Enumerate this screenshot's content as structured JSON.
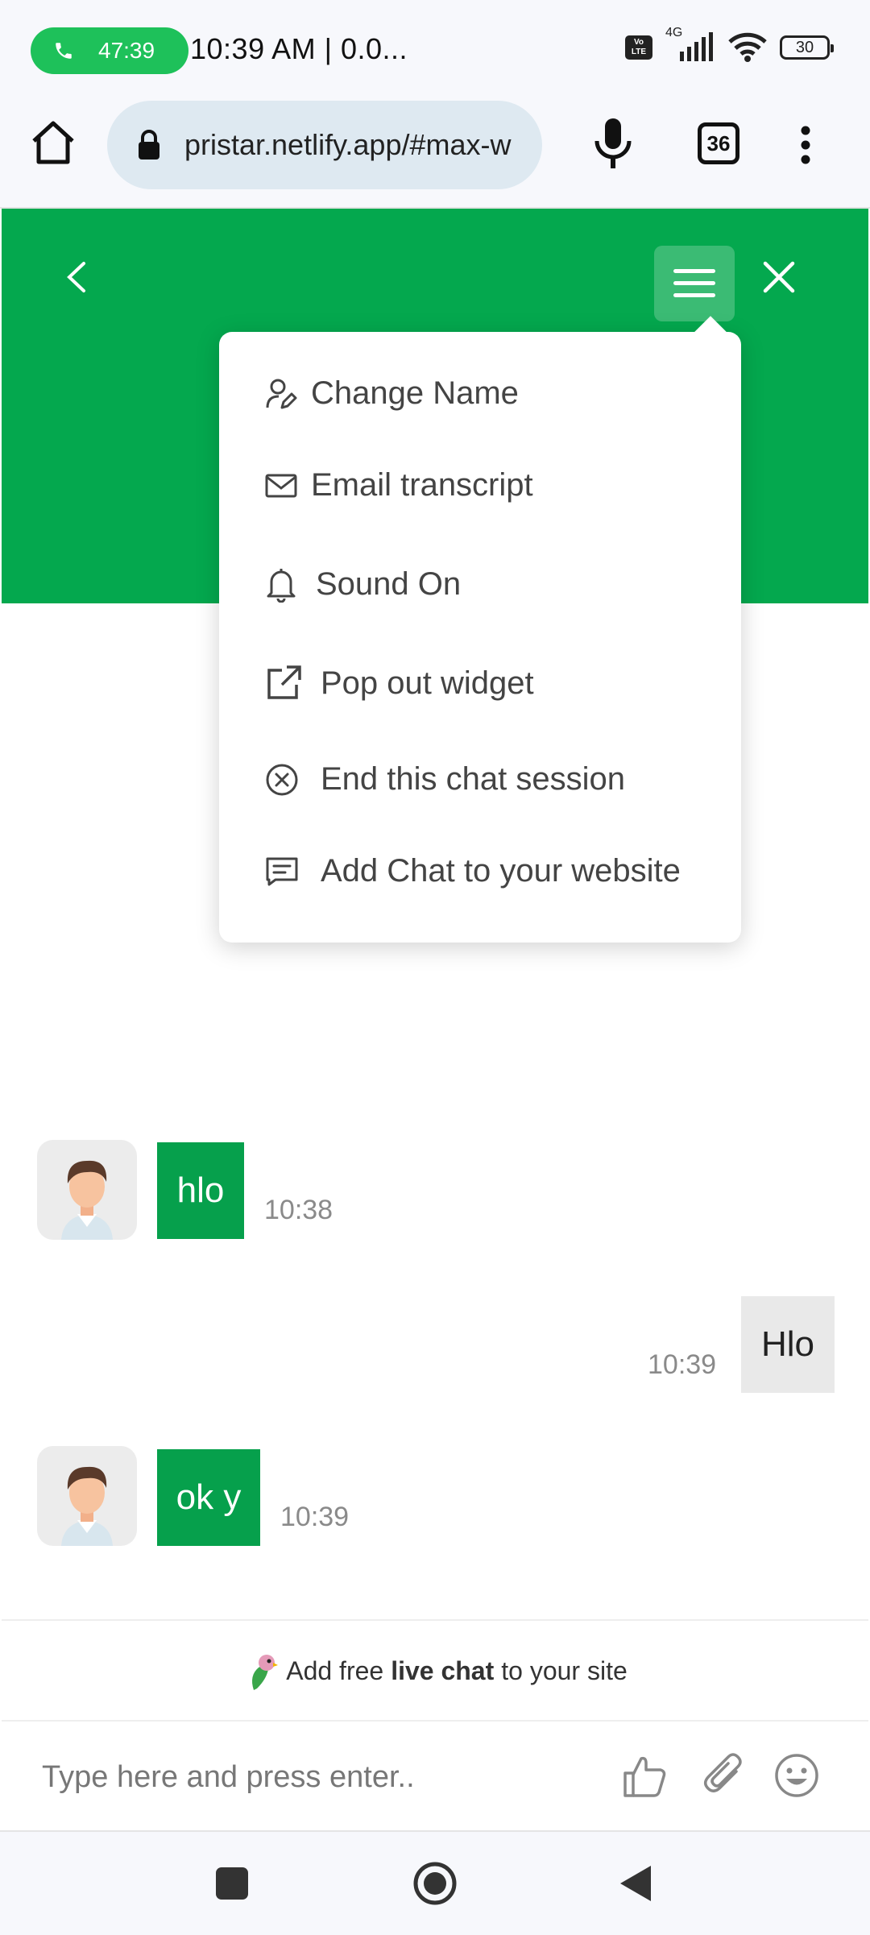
{
  "status_bar": {
    "call_timer": "47:39",
    "time_text": "10:39 AM | 0.0...",
    "network": "4G",
    "battery": "30",
    "volte": "Vo LTE"
  },
  "browser": {
    "url": "pristar.netlify.app/#max-w",
    "tab_count": "36"
  },
  "menu": {
    "items": [
      {
        "label": "Change Name",
        "icon": "user-edit-icon"
      },
      {
        "label": "Email transcript",
        "icon": "envelope-icon"
      },
      {
        "label": "Sound On",
        "icon": "bell-icon"
      },
      {
        "label": "Pop out widget",
        "icon": "external-link-icon"
      },
      {
        "label": "End this chat session",
        "icon": "close-circle-icon"
      },
      {
        "label": "Add Chat to your website",
        "icon": "chat-lines-icon"
      }
    ]
  },
  "messages": [
    {
      "sender": "agent",
      "text": "hlo",
      "time": "10:38"
    },
    {
      "sender": "user",
      "text": "Hlo",
      "time": "10:39"
    },
    {
      "sender": "agent",
      "text": "ok y",
      "time": "10:39"
    }
  ],
  "branding": {
    "prefix": "Add free",
    "bold": "live chat",
    "suffix": "to your site"
  },
  "composer": {
    "placeholder": "Type here and press enter.."
  },
  "colors": {
    "header_green": "#04a84e",
    "bubble_green": "#06a04c",
    "call_pill": "#1ec15a"
  }
}
